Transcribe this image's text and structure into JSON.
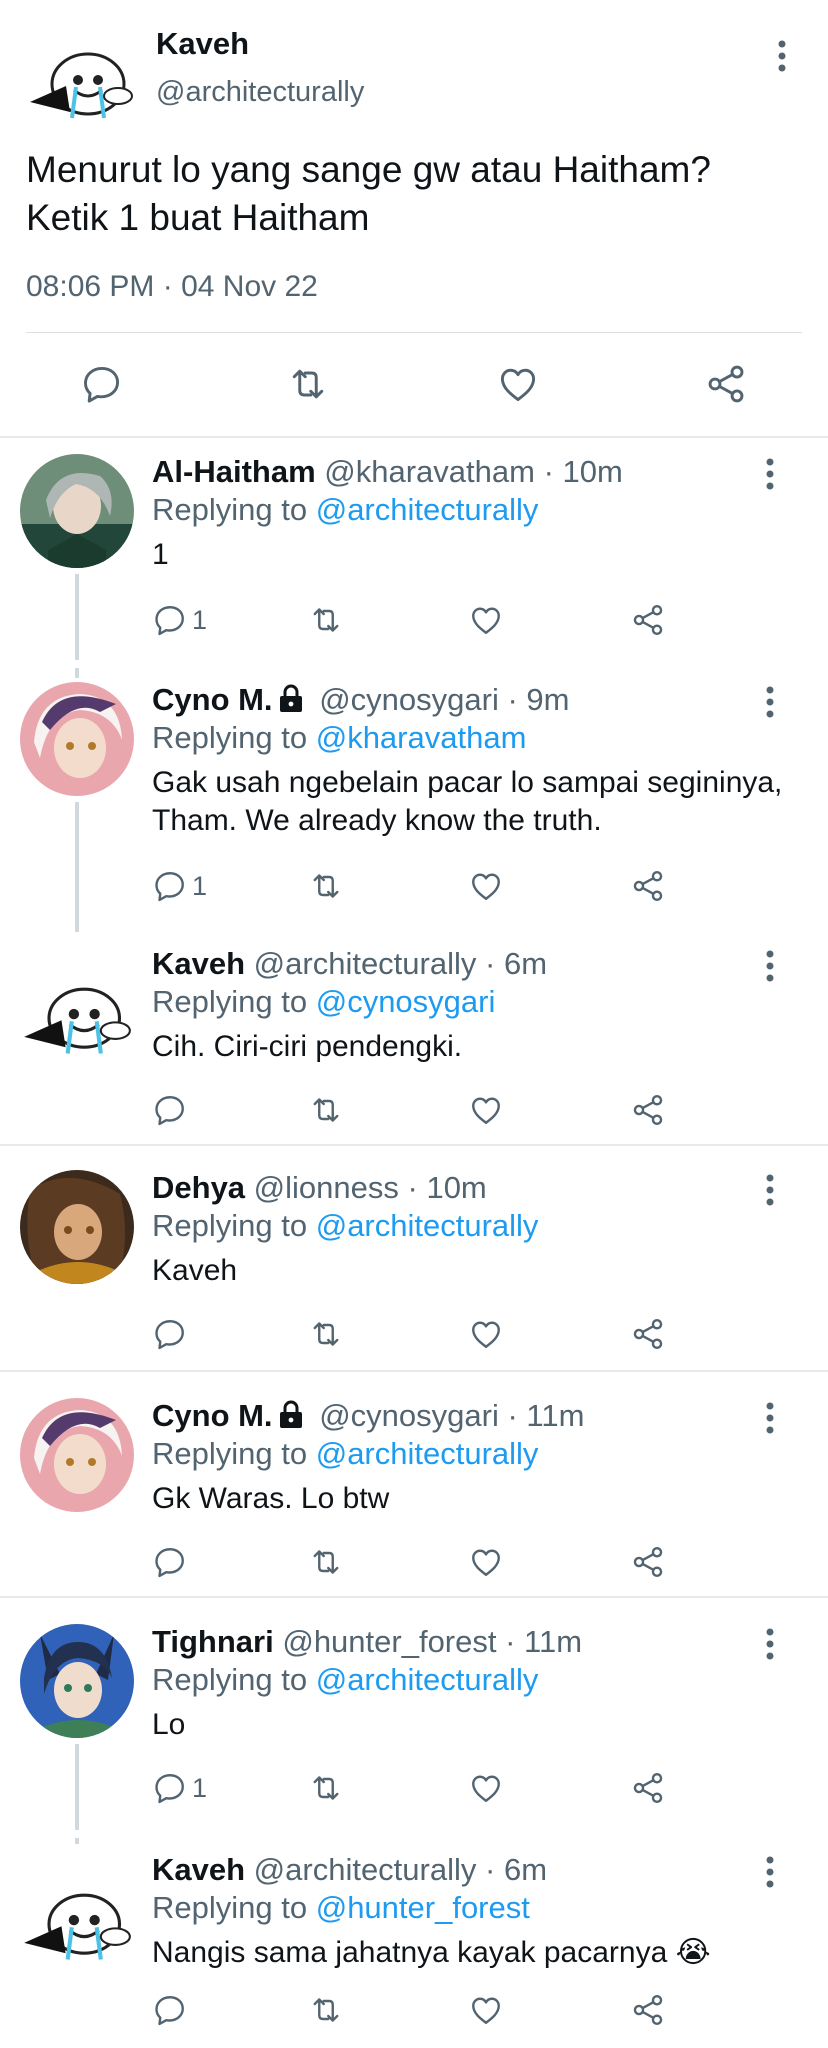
{
  "main_tweet": {
    "name": "Kaveh",
    "handle": "@architecturally",
    "text_line1": "Menurut lo yang sange gw atau Haitham?",
    "text_line2": "Ketik 1 buat Haitham",
    "timestamp": "08:06 PM · 04 Nov 22",
    "icons": [
      "reply-icon",
      "retweet-icon",
      "like-icon",
      "share-icon",
      "more-icon"
    ]
  },
  "replies": [
    {
      "name": "Al-Haitham",
      "handle": "@kharavatham",
      "time": "· 10m",
      "replying_label": "Replying to",
      "replying_to": "@architecturally",
      "text": "1",
      "reply_count": "1",
      "locked": false
    },
    {
      "name": "Cyno M.",
      "handle": "@cynosygari",
      "time": "· 9m",
      "replying_label": "Replying to",
      "replying_to": "@kharavatham",
      "text": "Gak usah ngebelain pacar lo sampai segininya, Tham. We already know the truth.",
      "reply_count": "1",
      "locked": true
    },
    {
      "name": "Kaveh",
      "handle": "@architecturally",
      "time": "· 6m",
      "replying_label": "Replying to",
      "replying_to": "@cynosygari",
      "text": "Cih. Ciri-ciri pendengki.",
      "reply_count": "",
      "locked": false
    },
    {
      "name": "Dehya",
      "handle": "@lionness",
      "time": "· 10m",
      "replying_label": "Replying to",
      "replying_to": "@architecturally",
      "text": "Kaveh",
      "reply_count": "",
      "locked": false
    },
    {
      "name": "Cyno M.",
      "handle": "@cynosygari",
      "time": "· 11m",
      "replying_label": "Replying to",
      "replying_to": "@architecturally",
      "text": "Gk Waras. Lo btw",
      "reply_count": "",
      "locked": true
    },
    {
      "name": "Tighnari",
      "handle": "@hunter_forest",
      "time": "· 11m",
      "replying_label": "Replying to",
      "replying_to": "@architecturally",
      "text": "Lo",
      "reply_count": "1",
      "locked": false
    },
    {
      "name": "Kaveh",
      "handle": "@architecturally",
      "time": "· 6m",
      "replying_label": "Replying to",
      "replying_to": "@hunter_forest",
      "text": "Nangis sama jahatnya kayak pacarnya 😭",
      "reply_count": "",
      "locked": false
    }
  ],
  "colors": {
    "accent": "#1d9bf0",
    "secondary_text": "#536471",
    "primary_text": "#0f1419",
    "divider": "#e7e9ea"
  }
}
